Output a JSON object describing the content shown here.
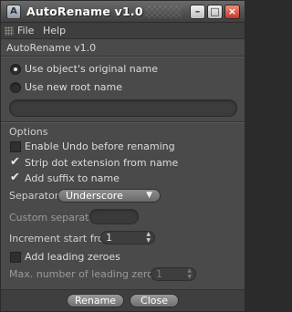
{
  "window": {
    "title": "AutoRename v1.0",
    "icon_name": "app-icon",
    "controls": {
      "minimize": "–",
      "maximize": "□",
      "close": "×"
    }
  },
  "menu": {
    "file": "File",
    "help": "Help"
  },
  "heading": "AutoRename v1.0",
  "naming": {
    "option_original": "Use object's original name",
    "option_new_root": "Use new root name",
    "selected": "original",
    "root_name_value": ""
  },
  "options": {
    "label": "Options",
    "enable_undo": {
      "label": "Enable Undo before renaming",
      "checked": false
    },
    "strip_dot": {
      "label": "Strip dot extension from name",
      "checked": true
    },
    "add_suffix": {
      "label": "Add suffix to name",
      "checked": true
    },
    "separator_label": "Separator",
    "separator_value": "Underscore",
    "custom_separator_label": "Custom separator",
    "custom_separator_value": "",
    "increment_label": "Increment start from",
    "increment_value": "1",
    "leading_zeroes": {
      "label": "Add leading zeroes",
      "checked": false
    },
    "max_leading_label": "Max. number of leading zeroes",
    "max_leading_value": "1"
  },
  "buttons": {
    "rename": "Rename",
    "close": "Close"
  },
  "colors": {
    "window_bg": "#4a4a4a",
    "title_gradient_top": "#6a6a6a",
    "close_button": "#c13a2a",
    "text": "#dcdcdc"
  }
}
